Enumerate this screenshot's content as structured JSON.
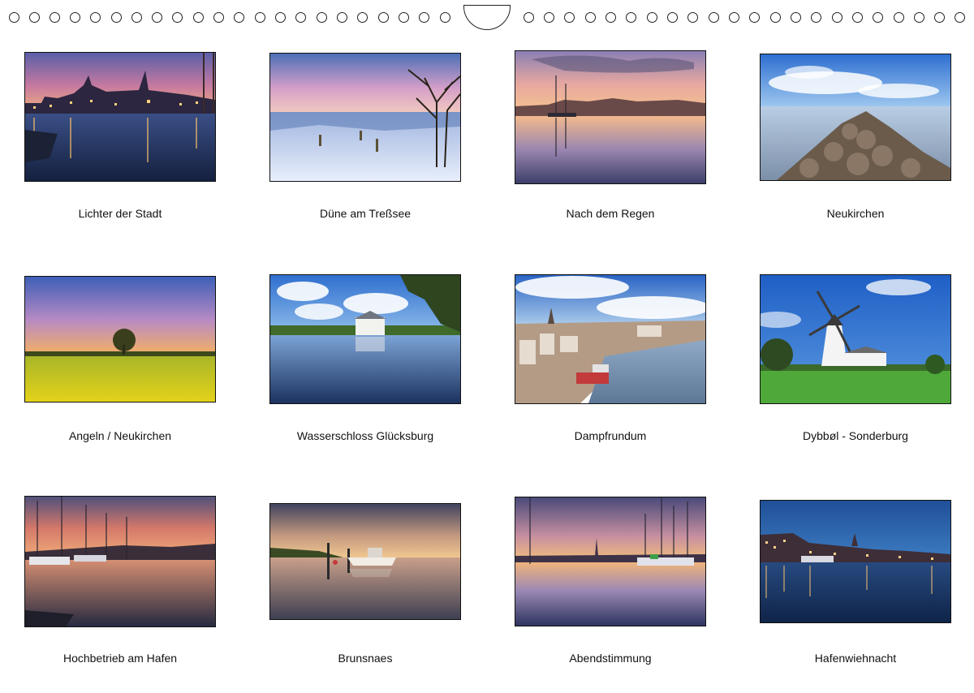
{
  "calendar_overview": {
    "months": [
      {
        "caption": "Lichter der Stadt"
      },
      {
        "caption": "Düne am Treßsee"
      },
      {
        "caption": "Nach dem Regen"
      },
      {
        "caption": "Neukirchen"
      },
      {
        "caption": "Angeln / Neukirchen"
      },
      {
        "caption": "Wasserschloss Glücksburg"
      },
      {
        "caption": "Dampfrundum"
      },
      {
        "caption": "Dybbøl - Sonderburg"
      },
      {
        "caption": "Hochbetrieb am Hafen"
      },
      {
        "caption": "Brunsnaes"
      },
      {
        "caption": "Abendstimmung"
      },
      {
        "caption": "Hafenwiehnacht"
      }
    ]
  },
  "colors": {
    "page_background": "#ffffff",
    "frame": "#111111",
    "text": "#111111"
  }
}
